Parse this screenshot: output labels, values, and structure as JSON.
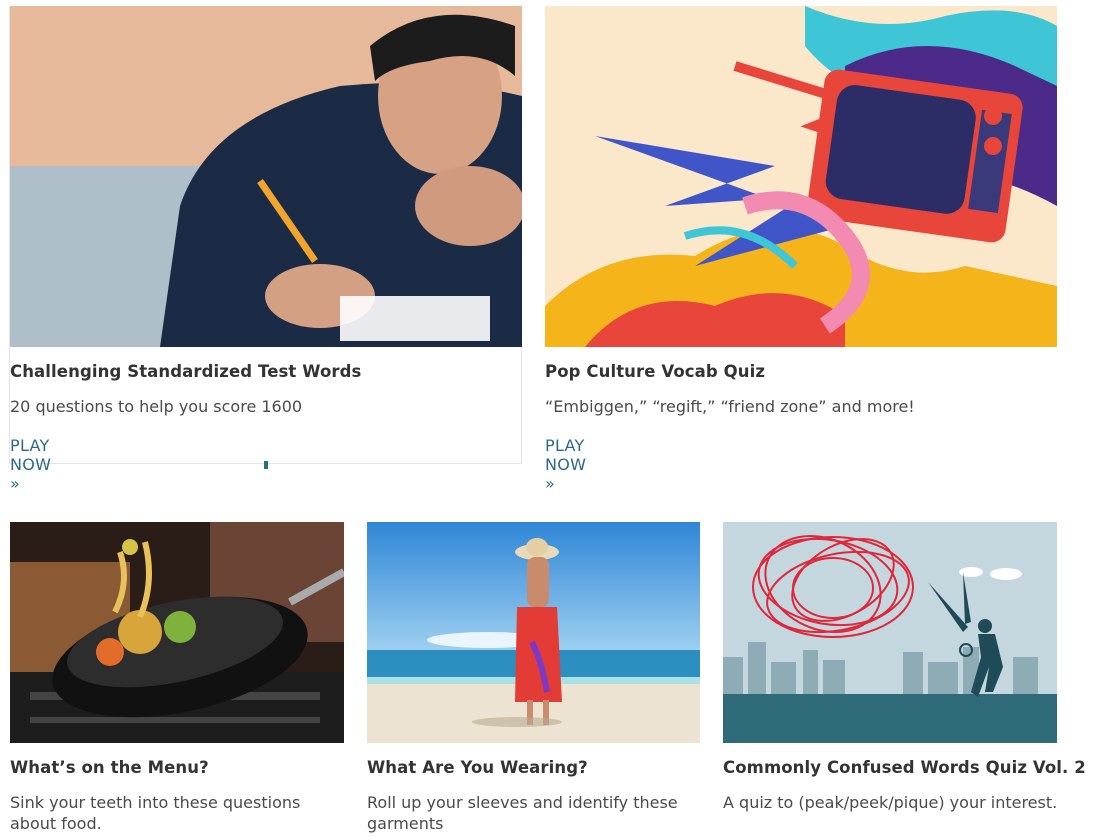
{
  "featured": [
    {
      "title": "Challenging Standardized Test Words",
      "description": "20 questions to help you score 1600",
      "cta": "PLAY NOW »",
      "image": "student-taking-test-photo"
    },
    {
      "title": "Pop Culture Vocab Quiz",
      "description": "“Embiggen,” “regift,” “friend zone” and more!",
      "cta": "PLAY NOW »",
      "image": "retro-tv-illustration"
    }
  ],
  "quizzes": [
    {
      "title": "What’s on the Menu?",
      "description": "Sink your teeth into these questions about food.",
      "image": "wok-stir-fry-photo"
    },
    {
      "title": "What Are You Wearing?",
      "description": "Roll up your sleeves and identify these garments",
      "image": "woman-on-beach-photo"
    },
    {
      "title": "Commonly Confused Words Quiz Vol. 2",
      "description": "A quiz to (peak/peek/pique) your interest.",
      "image": "scissors-cutting-tangle-illustration"
    }
  ],
  "colors": {
    "link": "#2d6a86",
    "title": "#333333",
    "text": "#4a4a4a"
  }
}
